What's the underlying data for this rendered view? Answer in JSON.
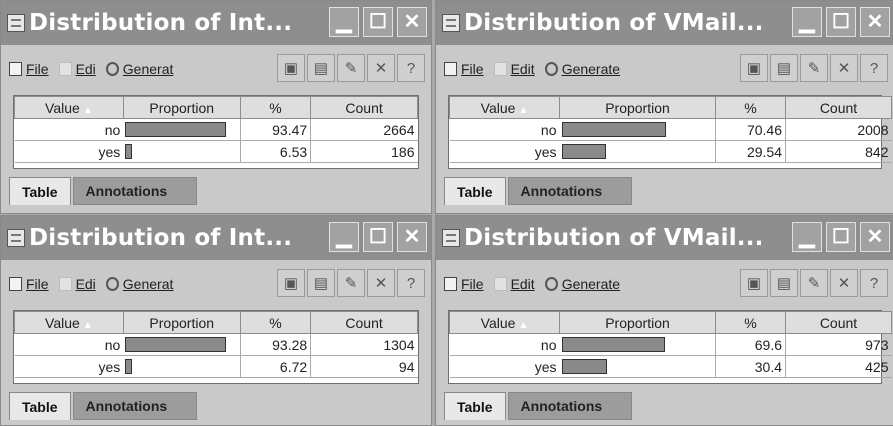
{
  "common": {
    "menu": {
      "file": "File",
      "edit": "Edit",
      "generate": "Generate"
    },
    "table_headers": {
      "value": "Value",
      "proportion": "Proportion",
      "percent": "%",
      "count": "Count"
    },
    "tabs": {
      "table": "Table",
      "annotations": "Annotations"
    },
    "icons": {
      "title": "distribution-window-icon",
      "minimize": "minimize-icon",
      "maximize": "maximize-icon",
      "close": "close-icon",
      "toolbar": [
        "save-icon",
        "print-icon",
        "export-icon",
        "delete-icon",
        "help-icon"
      ]
    }
  },
  "windows": [
    {
      "title": "Distribution of  Int...",
      "menu_labels": {
        "edit": "Edi",
        "generate": "Generat"
      },
      "rows": [
        {
          "value": "no",
          "proportion": 0.9347,
          "percent": "93.47",
          "count": "2664"
        },
        {
          "value": "yes",
          "proportion": 0.0653,
          "percent": "6.53",
          "count": "186"
        }
      ]
    },
    {
      "title": "Distribution of  VMail...",
      "menu_labels": {
        "edit": "Edit",
        "generate": "Generate"
      },
      "rows": [
        {
          "value": "no",
          "proportion": 0.7046,
          "percent": "70.46",
          "count": "2008"
        },
        {
          "value": "yes",
          "proportion": 0.2954,
          "percent": "29.54",
          "count": "842"
        }
      ]
    },
    {
      "title": "Distribution of  Int...",
      "menu_labels": {
        "edit": "Edi",
        "generate": "Generat"
      },
      "rows": [
        {
          "value": "no",
          "proportion": 0.9328,
          "percent": "93.28",
          "count": "1304"
        },
        {
          "value": "yes",
          "proportion": 0.0672,
          "percent": "6.72",
          "count": "94"
        }
      ]
    },
    {
      "title": "Distribution of  VMail...",
      "menu_labels": {
        "edit": "Edit",
        "generate": "Generate"
      },
      "rows": [
        {
          "value": "no",
          "proportion": 0.696,
          "percent": "69.6",
          "count": "973"
        },
        {
          "value": "yes",
          "proportion": 0.304,
          "percent": "30.4",
          "count": "425"
        }
      ]
    }
  ]
}
